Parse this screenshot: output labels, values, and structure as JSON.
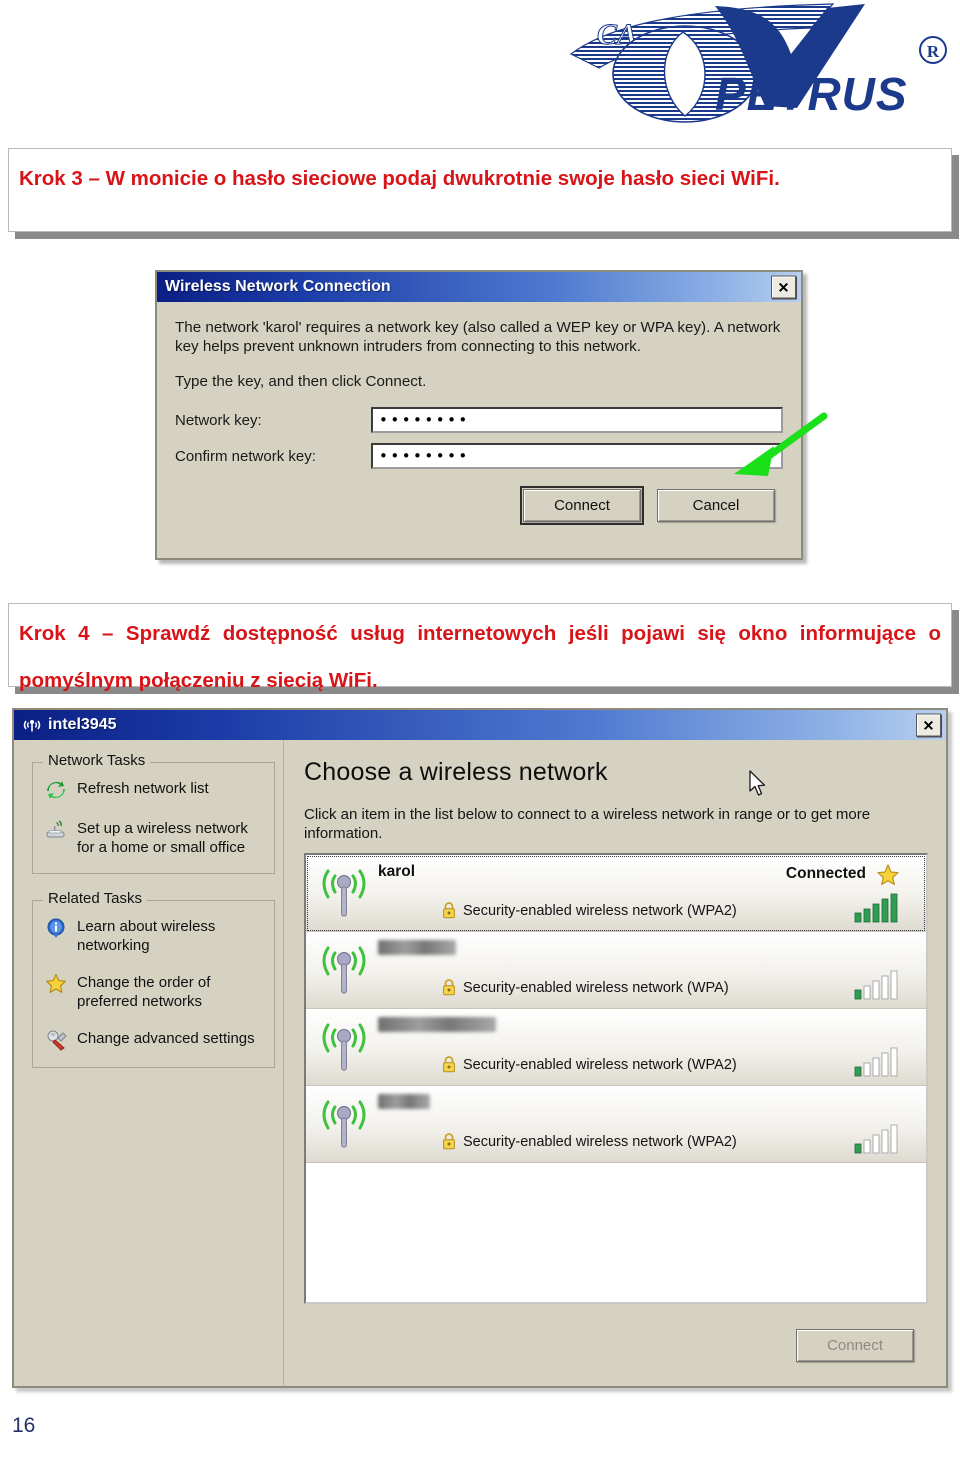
{
  "page": {
    "number": "16",
    "logo": {
      "brand": "PETRUS",
      "mark": "CA",
      "registered": "®"
    }
  },
  "steps": [
    {
      "id": "step3",
      "text": "Krok 3 – W monicie o hasło sieciowe podaj dwukrotnie swoje hasło sieci WiFi."
    },
    {
      "id": "step4",
      "text": "Krok 4 – Sprawdź dostępność usług internetowych jeśli pojawi się okno informujące o pomyślnym połączeniu z siecią WiFi."
    }
  ],
  "dialog": {
    "title": "Wireless Network Connection",
    "close_label": "✕",
    "paragraph1": "The network 'karol' requires a network key (also called a WEP key or WPA key). A network key helps prevent unknown intruders from connecting to this network.",
    "paragraph2": "Type the key, and then click Connect.",
    "fields": [
      {
        "label": "Network key:",
        "value": "••••••••",
        "placeholder": ""
      },
      {
        "label": "Confirm network key:",
        "value": "••••••••",
        "placeholder": ""
      }
    ],
    "buttons": [
      {
        "label": "Connect",
        "default": true
      },
      {
        "label": "Cancel",
        "default": false
      }
    ],
    "annotation": {
      "type": "arrow",
      "color": "#19e019",
      "points_to": "Network key:"
    }
  },
  "window": {
    "title": "intel3945",
    "close_label": "✕",
    "heading": "Choose a wireless network",
    "hint": "Click an item in the list below to connect to a wireless network in range or to get more information.",
    "sidebar": {
      "groups": [
        {
          "title": "Network Tasks",
          "tasks": [
            {
              "icon": "refresh-icon",
              "label": "Refresh network list"
            },
            {
              "icon": "wireless-router-icon",
              "label": "Set up a wireless network for a home or small office"
            }
          ]
        },
        {
          "title": "Related Tasks",
          "tasks": [
            {
              "icon": "info-icon",
              "label": "Learn about wireless networking"
            },
            {
              "icon": "star-icon",
              "label": "Change the order of preferred networks"
            },
            {
              "icon": "wrench-icon",
              "label": "Change advanced settings"
            }
          ]
        }
      ]
    },
    "networks": [
      {
        "ssid": "karol",
        "redacted": false,
        "security": "Security-enabled wireless network (WPA2)",
        "status": "Connected",
        "preferred": true,
        "selected": true,
        "signal_bars": 5
      },
      {
        "ssid": "",
        "redacted": true,
        "security": "Security-enabled wireless network (WPA)",
        "status": "",
        "preferred": false,
        "selected": false,
        "signal_bars": 1
      },
      {
        "ssid": "",
        "redacted": true,
        "security": "Security-enabled wireless network (WPA2)",
        "status": "",
        "preferred": false,
        "selected": false,
        "signal_bars": 1
      },
      {
        "ssid": "",
        "redacted": true,
        "security": "Security-enabled wireless network (WPA2)",
        "status": "",
        "preferred": false,
        "selected": false,
        "signal_bars": 1
      }
    ],
    "connect_button": {
      "label": "Connect",
      "disabled": true
    }
  },
  "colors": {
    "step_text": "#d81418",
    "titlebar_start": "#0b1f84",
    "titlebar_end": "#b9cff0",
    "window_face": "#d6d2c2",
    "arrow_green": "#19e019",
    "page_number": "#26306b",
    "signal_green": "#2f9e52",
    "logo_blue": "#1b3a8c"
  }
}
